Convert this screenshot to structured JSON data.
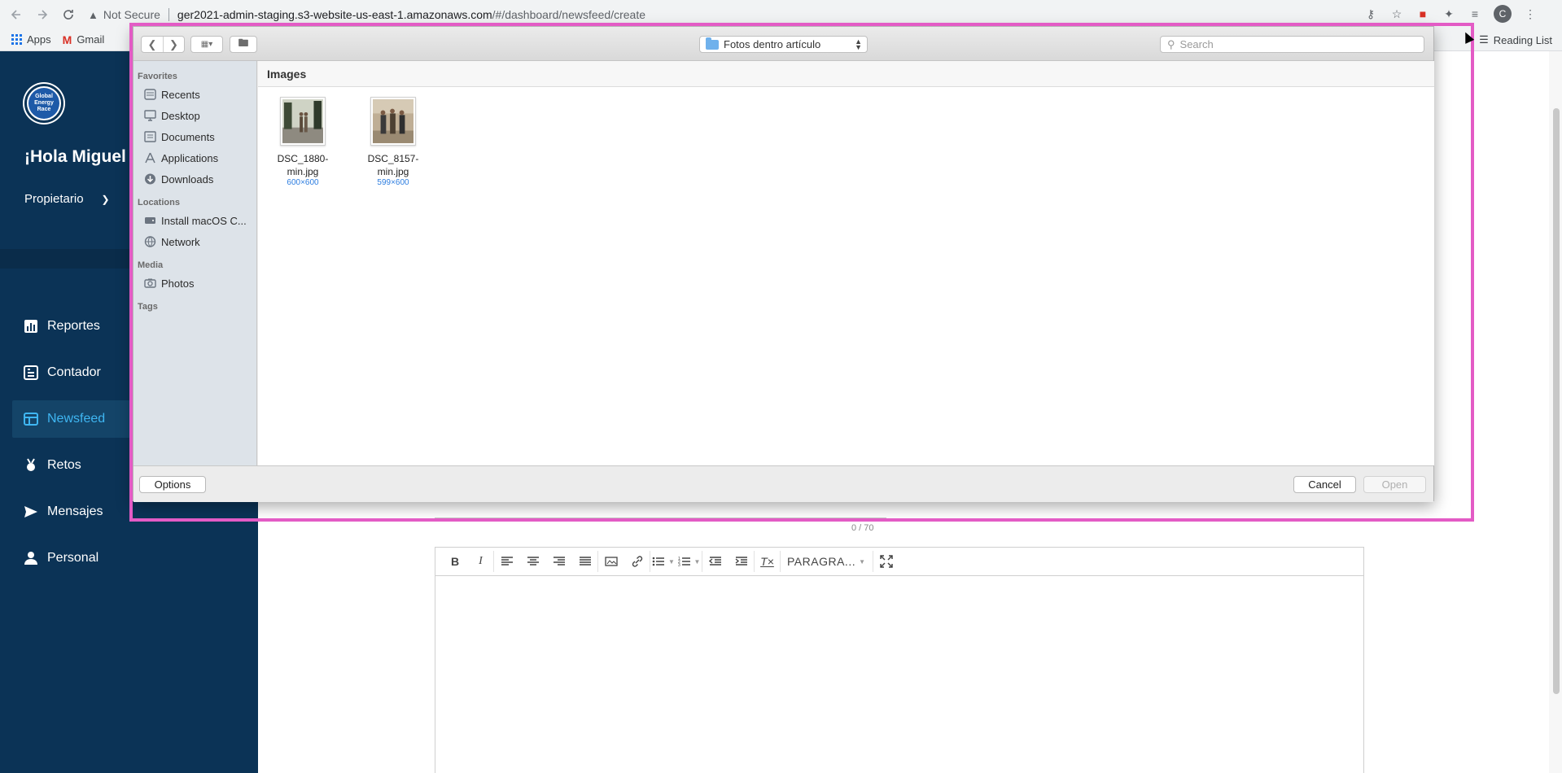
{
  "browser": {
    "security_label": "Not Secure",
    "url_host": "ger2021-admin-staging.s3-website-us-east-1.amazonaws.com",
    "url_path": "/#/dashboard/newsfeed/create",
    "profile_initial": "C",
    "bookmarks": {
      "apps": "Apps",
      "gmail": "Gmail"
    },
    "reading_list": "Reading List"
  },
  "app": {
    "logo_text": "Global Energy Race",
    "greeting": "¡Hola Miguel L",
    "role": "Propietario",
    "menu": [
      {
        "label": "Reportes",
        "icon": "chart-icon",
        "active": false
      },
      {
        "label": "Contador",
        "icon": "counter-icon",
        "active": false
      },
      {
        "label": "Newsfeed",
        "icon": "newsfeed-icon",
        "active": true
      },
      {
        "label": "Retos",
        "icon": "medal-icon",
        "active": false
      },
      {
        "label": "Mensajes",
        "icon": "send-icon",
        "active": false
      },
      {
        "label": "Personal",
        "icon": "person-icon",
        "active": false
      }
    ],
    "counter_text": "0 / 70",
    "editor_paragraph": "PARAGRA..."
  },
  "dialog": {
    "current_folder": "Fotos dentro artículo",
    "search_placeholder": "Search",
    "section_title": "Images",
    "sidebar": {
      "favorites_header": "Favorites",
      "favorites": [
        {
          "label": "Recents",
          "icon": "recents-icon"
        },
        {
          "label": "Desktop",
          "icon": "desktop-icon"
        },
        {
          "label": "Documents",
          "icon": "documents-icon"
        },
        {
          "label": "Applications",
          "icon": "applications-icon"
        },
        {
          "label": "Downloads",
          "icon": "downloads-icon"
        }
      ],
      "locations_header": "Locations",
      "locations": [
        {
          "label": "Install macOS C...",
          "icon": "disk-icon"
        },
        {
          "label": "Network",
          "icon": "network-icon"
        }
      ],
      "media_header": "Media",
      "media": [
        {
          "label": "Photos",
          "icon": "camera-icon"
        }
      ],
      "tags_header": "Tags"
    },
    "files": [
      {
        "name_line1": "DSC_1880-",
        "name_line2": "min.jpg",
        "dimensions": "600×600"
      },
      {
        "name_line1": "DSC_8157-",
        "name_line2": "min.jpg",
        "dimensions": "599×600"
      }
    ],
    "buttons": {
      "options": "Options",
      "cancel": "Cancel",
      "open": "Open"
    }
  },
  "colors": {
    "sidebar_bg": "#0b3356",
    "active_item": "#3fb6f2",
    "dialog_highlight": "#e35bc5"
  }
}
